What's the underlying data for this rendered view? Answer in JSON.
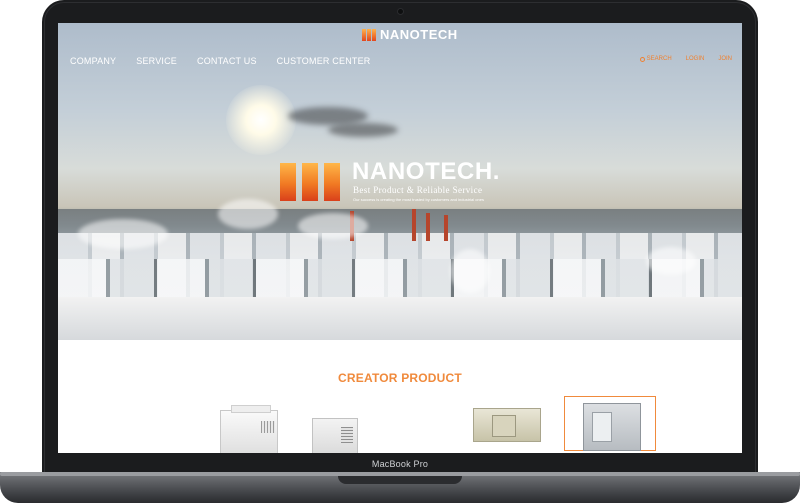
{
  "device": {
    "label": "MacBook Pro"
  },
  "header": {
    "logo_text": "NANOTECH",
    "nav": [
      "COMPANY",
      "SERVICE",
      "CONTACT US",
      "CUSTOMER CENTER"
    ],
    "utility": [
      "SEARCH",
      "LOGIN",
      "JOIN"
    ]
  },
  "hero": {
    "brand_name": "NANOTECH.",
    "tagline": "Best Product & Reliable Service",
    "description": "Our success is creating the most trusted by customers and industrial ones"
  },
  "products": {
    "section_title": "CREATOR PRODUCT"
  },
  "colors": {
    "accent": "#f08a3c",
    "logo_gradient_top": "#ffb24a",
    "logo_gradient_bottom": "#e2471d"
  }
}
